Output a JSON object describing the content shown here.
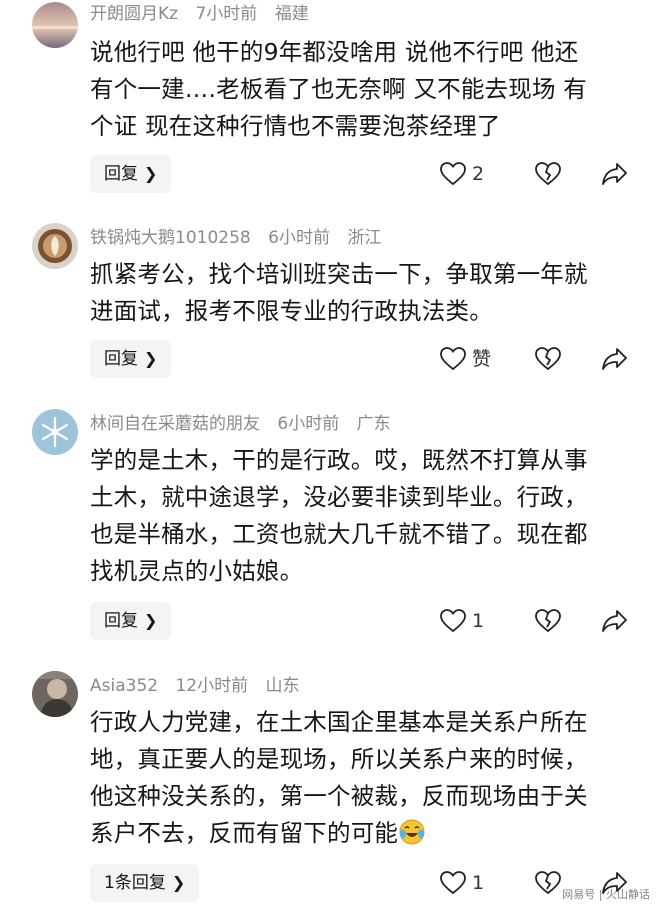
{
  "comments": [
    {
      "username": "开朗圆月Kz",
      "time": "7小时前",
      "location": "福建",
      "lines": [
        "说他行吧 他干的9年都没啥用 说他不行吧 他还",
        "有个一建….老板看了也无奈啊 又不能去现场 有",
        "个证 现在这种行情也不需要泡茶经理了"
      ],
      "reply_label": "回复",
      "like_count": "2"
    },
    {
      "username": "铁锅炖大鹅1010258",
      "time": "6小时前",
      "location": "浙江",
      "lines": [
        "抓紧考公，找个培训班突击一下，争取第一年就",
        "进面试，报考不限专业的行政执法类。"
      ],
      "reply_label": "回复",
      "like_count": "赞"
    },
    {
      "username": "林间自在采蘑菇的朋友",
      "time": "6小时前",
      "location": "广东",
      "lines": [
        "学的是土木，干的是行政。哎，既然不打算从事",
        "土木，就中途退学，没必要非读到毕业。行政，",
        "也是半桶水，工资也就大几千就不错了。现在都",
        "找机灵点的小姑娘。"
      ],
      "reply_label": "回复",
      "like_count": "1"
    },
    {
      "username": "Asia352",
      "time": "12小时前",
      "location": "山东",
      "lines": [
        "行政人力党建，在土木国企里基本是关系户所在",
        "地，真正要人的是现场，所以关系户来的时候，",
        "他这种没关系的，第一个被裁，反而现场由于关",
        "系户不去，反而有留下的可能"
      ],
      "reply_label": "1条回复",
      "like_count": "1"
    }
  ],
  "icons": {
    "like": "heart-outline-icon",
    "dislike": "broken-heart-icon",
    "share": "share-arrow-icon",
    "chevron": "chevron-right-icon",
    "emoji": "crying-laughing-emoji-icon"
  },
  "watermark": "网易号 | 火山静话",
  "colors": {
    "meta_text": "#8a8a8a",
    "body_text": "#161616",
    "reply_bg": "#f4f4f5"
  }
}
